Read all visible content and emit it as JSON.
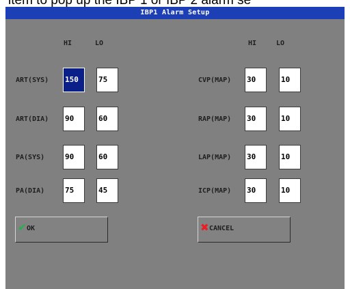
{
  "caption": "ltem to pop up the IBP 1 or IBP 2 alarm se",
  "dialog": {
    "title": "IBP1 Alarm Setup",
    "columns": {
      "hi": "HI",
      "lo": "LO"
    },
    "left": [
      {
        "label": "ART(SYS)",
        "hi": "150",
        "lo": "75"
      },
      {
        "label": "ART(DIA)",
        "hi": "90",
        "lo": "60"
      },
      {
        "label": "PA(SYS)",
        "hi": "90",
        "lo": "60"
      },
      {
        "label": "PA(DIA)",
        "hi": "75",
        "lo": "45"
      }
    ],
    "right": [
      {
        "label": "CVP(MAP)",
        "hi": "30",
        "lo": "10"
      },
      {
        "label": "RAP(MAP)",
        "hi": "30",
        "lo": "10"
      },
      {
        "label": "LAP(MAP)",
        "hi": "30",
        "lo": "10"
      },
      {
        "label": "ICP(MAP)",
        "hi": "30",
        "lo": "10"
      }
    ],
    "ok_label": "OK",
    "cancel_label": "CANCEL",
    "ok_icon": "check-icon",
    "cancel_icon": "x-icon",
    "colors": {
      "title_bar": "#1d3fb5",
      "background": "#808080",
      "selected": "#0a1f87",
      "ok_icon": "#22b14c",
      "cancel_icon": "#ed1c24"
    }
  }
}
